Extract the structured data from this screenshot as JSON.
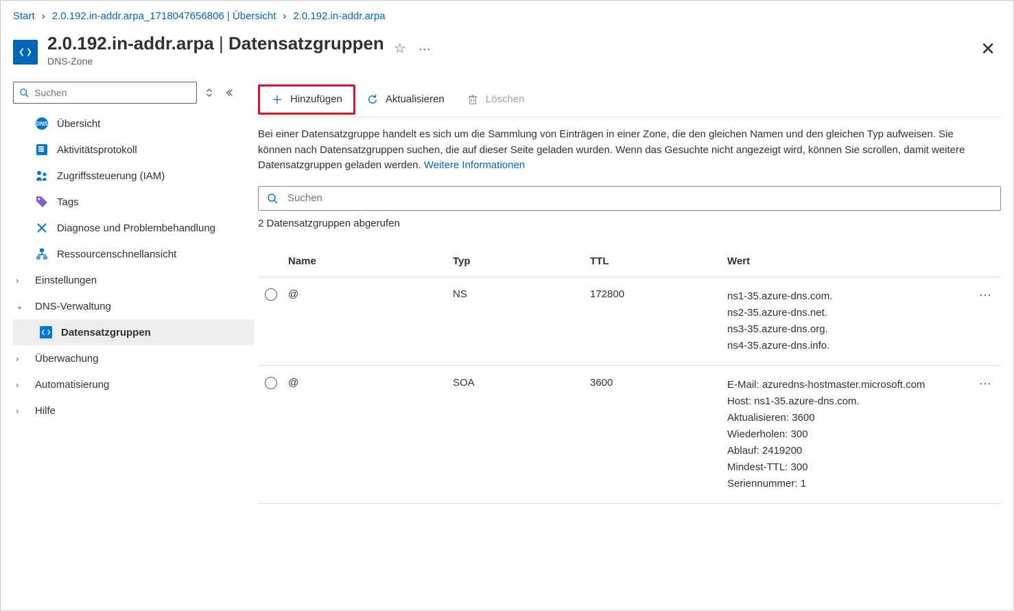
{
  "breadcrumbs": {
    "items": [
      {
        "label": "Start"
      },
      {
        "label": "2.0.192.in-addr.arpa_1718047656806 | Übersicht"
      },
      {
        "label": "2.0.192.in-addr.arpa"
      }
    ]
  },
  "header": {
    "title_zone": "2.0.192.in-addr.arpa",
    "title_sep": " | ",
    "title_section": "Datensatzgruppen",
    "subtitle": "DNS-Zone"
  },
  "sidebar": {
    "search_placeholder": "Suchen",
    "items": {
      "overview": "Übersicht",
      "activity": "Aktivitätsprotokoll",
      "iam": "Zugriffssteuerung (IAM)",
      "tags": "Tags",
      "diagnose": "Diagnose und Problembehandlung",
      "resourcevis": "Ressourcenschnellansicht",
      "settings": "Einstellungen",
      "dnsmgmt": "DNS-Verwaltung",
      "recordsets": "Datensatzgruppen",
      "monitoring": "Überwachung",
      "automation": "Automatisierung",
      "help": "Hilfe"
    }
  },
  "toolbar": {
    "add": "Hinzufügen",
    "refresh": "Aktualisieren",
    "delete": "Löschen"
  },
  "intro": {
    "text": "Bei einer Datensatzgruppe handelt es sich um die Sammlung von Einträgen in einer Zone, die den gleichen Namen und den gleichen Typ aufweisen. Sie können nach Datensatzgruppen suchen, die auf dieser Seite geladen wurden. Wenn das Gesuchte nicht angezeigt wird, können Sie scrollen, damit weitere Datensatzgruppen geladen werden. ",
    "link": "Weitere Informationen"
  },
  "table": {
    "search_placeholder": "Suchen",
    "count": "2 Datensatzgruppen abgerufen",
    "cols": {
      "name": "Name",
      "type": "Typ",
      "ttl": "TTL",
      "value": "Wert"
    },
    "rows": [
      {
        "name": "@",
        "type": "NS",
        "ttl": "172800",
        "values": [
          "ns1-35.azure-dns.com.",
          "ns2-35.azure-dns.net.",
          "ns3-35.azure-dns.org.",
          "ns4-35.azure-dns.info."
        ]
      },
      {
        "name": "@",
        "type": "SOA",
        "ttl": "3600",
        "values": [
          "E-Mail: azuredns-hostmaster.microsoft.com",
          "Host: ns1-35.azure-dns.com.",
          "Aktualisieren: 3600",
          "Wiederholen: 300",
          "Ablauf: 2419200",
          "Mindest-TTL: 300",
          "Seriennummer: 1"
        ]
      }
    ]
  }
}
